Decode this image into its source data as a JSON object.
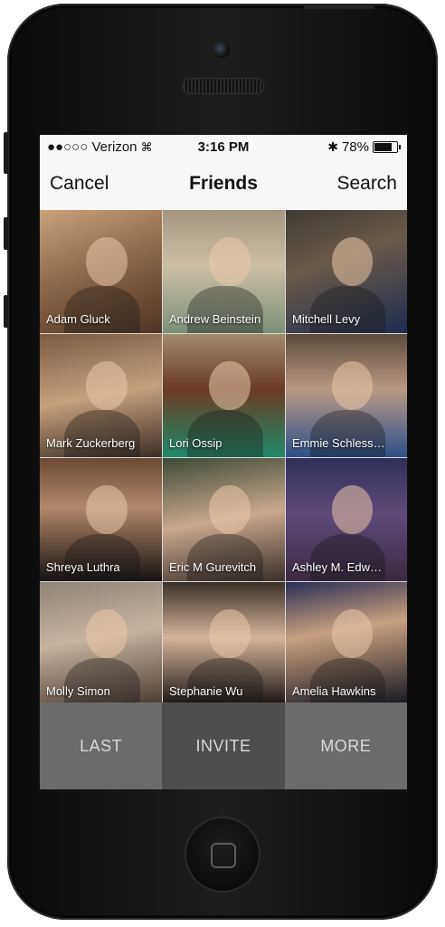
{
  "status_bar": {
    "carrier": "●●○○○ Verizon",
    "time": "3:16 PM",
    "battery": "78%"
  },
  "nav": {
    "left": "Cancel",
    "title": "Friends",
    "right": "Search"
  },
  "friends": [
    {
      "name": "Adam Gluck",
      "bg": "linear-gradient(160deg,#c9a37a 0%,#8a6446 50%,#4d3526 100%)"
    },
    {
      "name": "Andrew Beinstein",
      "bg": "linear-gradient(180deg,#a49580 0%,#cdbfa7 45%,#7c8f78 100%)"
    },
    {
      "name": "Mitchell Levy",
      "bg": "linear-gradient(160deg,#3f3a33 0%,#6a5a4a 40%,#1f2d4f 100%)"
    },
    {
      "name": "Mark Zuckerberg",
      "bg": "linear-gradient(170deg,#7a5b43 0%,#c7a07c 50%,#3b2e27 100%)"
    },
    {
      "name": "Lori Ossip",
      "bg": "linear-gradient(180deg,#a28a6d 0%,#6b3b24 45%,#1f8a6a 100%)"
    },
    {
      "name": "Emmie Schless…",
      "bg": "linear-gradient(180deg,#5c4a3c 0%,#b89a84 45%,#2e4f8a 100%)"
    },
    {
      "name": "Shreya Luthra",
      "bg": "linear-gradient(180deg,#6b4a36 0%,#b3876a 40%,#161212 100%)"
    },
    {
      "name": "Eric M Gurevitch",
      "bg": "linear-gradient(170deg,#3d4a36 0%,#c9a88f 50%,#3a2f2a 100%)"
    },
    {
      "name": "Ashley M. Edw…",
      "bg": "linear-gradient(180deg,#2f2f5a 0%,#5f4a7a 45%,#3a2a3f 100%)"
    },
    {
      "name": "Molly Simon",
      "bg": "linear-gradient(170deg,#8f8478 0%,#c6b3a0 45%,#4a3a30 100%)"
    },
    {
      "name": "Stephanie Wu",
      "bg": "linear-gradient(180deg,#3a3128 0%,#d5b49b 45%,#1a1614 100%)"
    },
    {
      "name": "Amelia Hawkins",
      "bg": "linear-gradient(170deg,#2a2f55 0%,#c9a07f 40%,#141622 100%)"
    }
  ],
  "bottom_bar": {
    "last": "LAST",
    "invite": "INVITE",
    "more": "MORE"
  },
  "colors": {
    "bottom_left": "#6b6b6b",
    "bottom_middle": "#4e4e4e",
    "bottom_right": "#6b6b6b"
  }
}
